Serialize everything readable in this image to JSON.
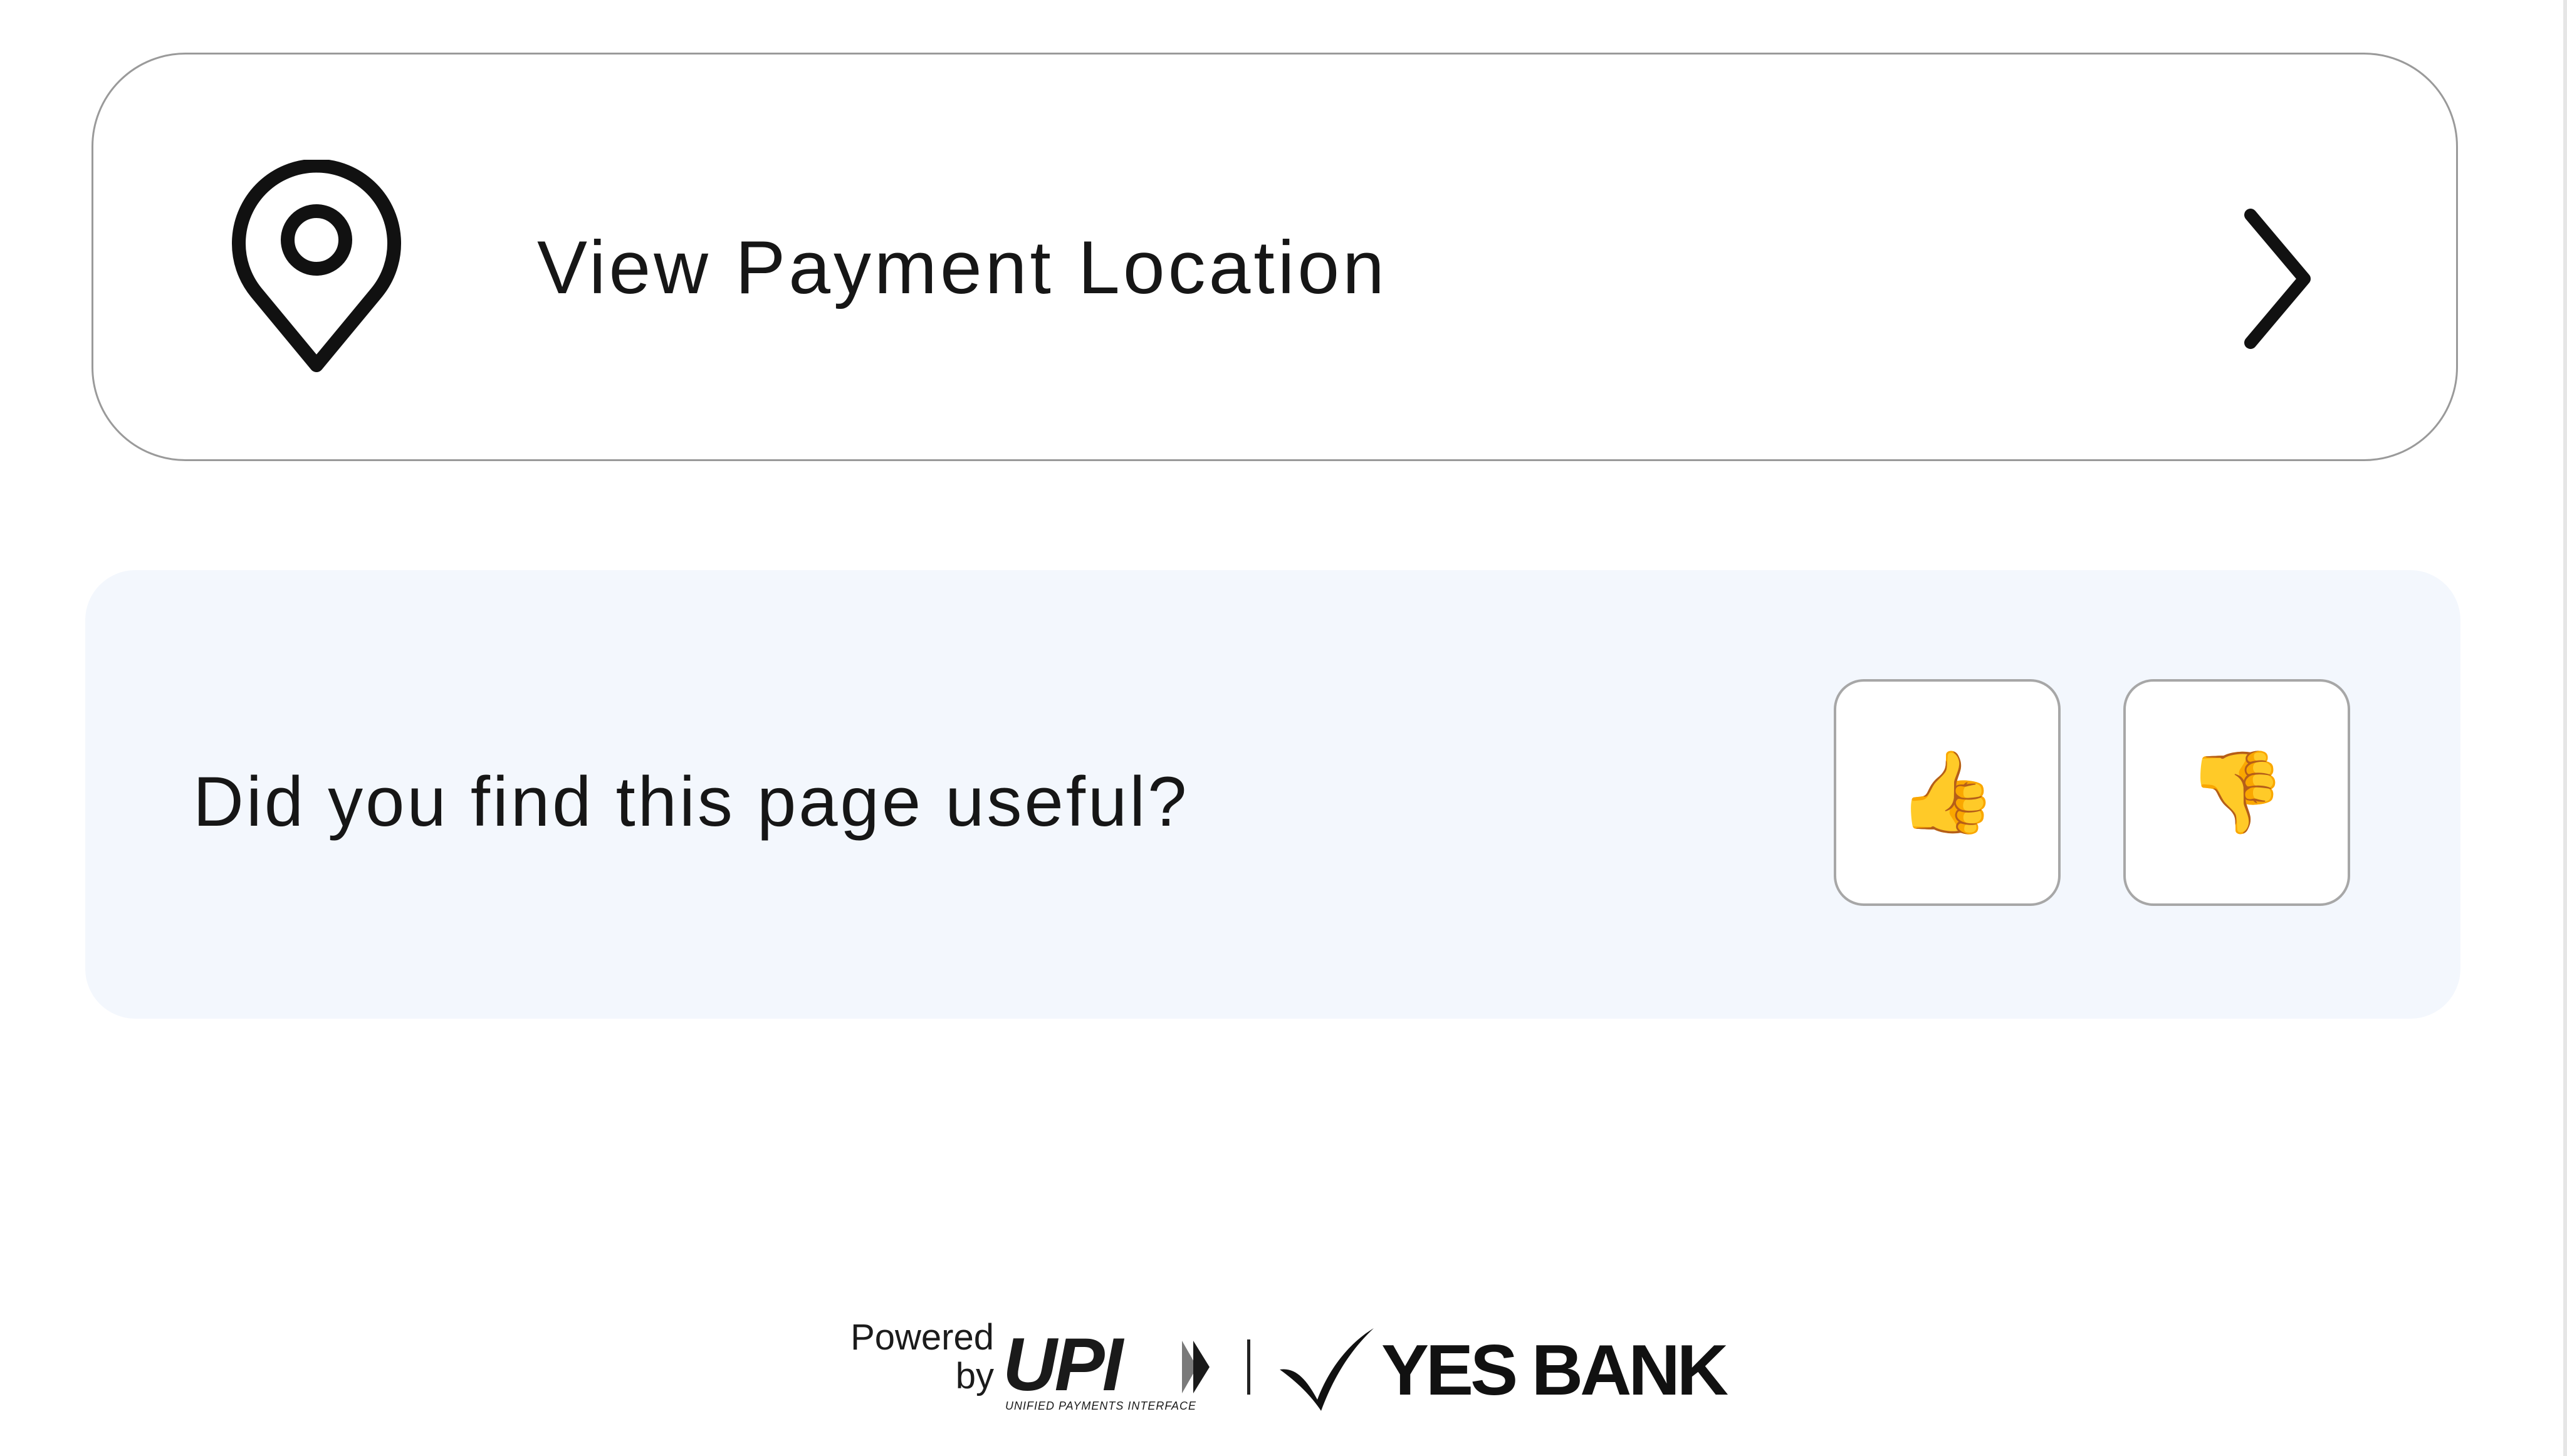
{
  "location_card": {
    "label": "View Payment Location",
    "icon": "map-pin-icon",
    "trailing_icon": "chevron-right-icon"
  },
  "feedback": {
    "question": "Did you find this page useful?",
    "thumbs_up": "👍",
    "thumbs_down": "👎"
  },
  "footer": {
    "powered_line1": "Powered",
    "powered_line2": "by",
    "upi_text": "UPI",
    "upi_subtext": "UNIFIED PAYMENTS INTERFACE",
    "bank_name": "YES BANK"
  },
  "colors": {
    "panel_background": "#f3f7fd",
    "card_border": "#9a9a9a",
    "emoji_yellow": "#f6b715"
  }
}
